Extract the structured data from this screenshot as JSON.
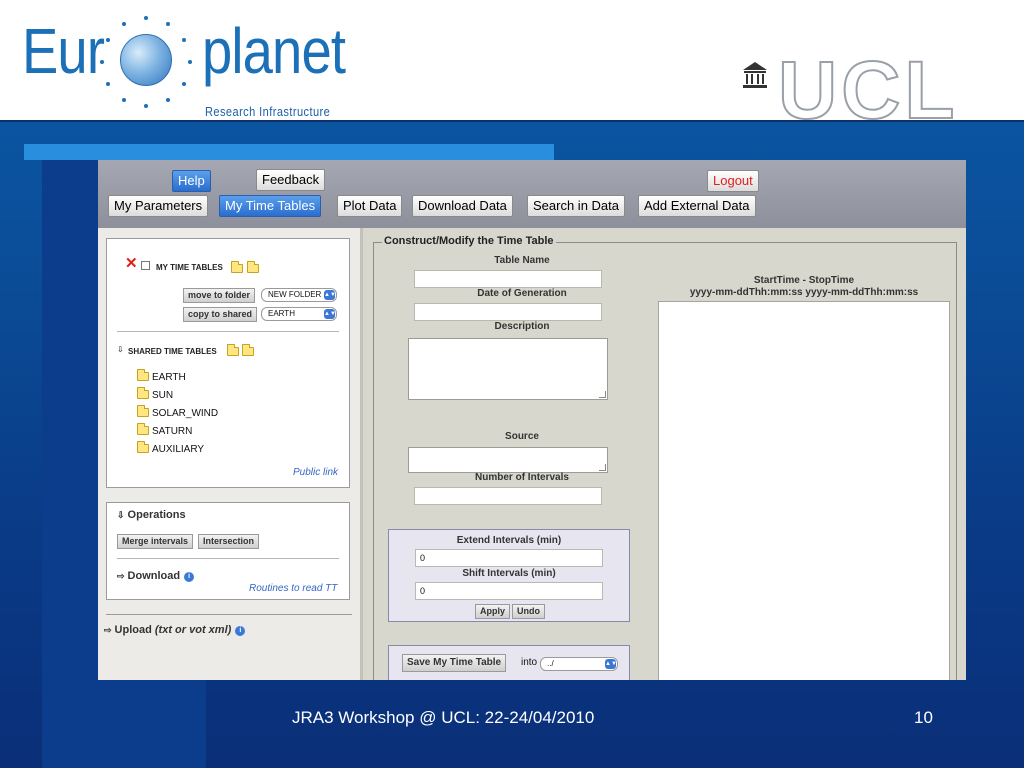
{
  "header": {
    "logo_left_part": "Eur",
    "logo_right_part": "planet",
    "logo_subtitle": "Research Infrastructure",
    "institution_logo": "UCL"
  },
  "toolbar": {
    "help_label": "Help",
    "feedback_label": "Feedback",
    "logout_label": "Logout",
    "tabs": [
      {
        "label": "My Parameters"
      },
      {
        "label": "My Time Tables"
      },
      {
        "label": "Plot Data"
      },
      {
        "label": "Download Data"
      },
      {
        "label": "Search in Data"
      },
      {
        "label": "Add External Data"
      }
    ]
  },
  "my_time_tables": {
    "title": "MY TIME TABLES",
    "move_to_folder_label": "move to folder",
    "move_to_folder_selected": "NEW FOLDER",
    "copy_to_shared_label": "copy to shared",
    "copy_to_shared_selected": "EARTH",
    "shared_title": "SHARED TIME TABLES",
    "folders": [
      {
        "name": "EARTH"
      },
      {
        "name": "SUN"
      },
      {
        "name": "SOLAR_WIND"
      },
      {
        "name": "SATURN"
      },
      {
        "name": "AUXILIARY"
      }
    ],
    "public_link": "Public link"
  },
  "operations": {
    "title": "Operations",
    "merge_label": "Merge intervals",
    "intersection_label": "Intersection",
    "download_title": "Download",
    "routines_link": "Routines to read TT",
    "upload_title": "Upload",
    "upload_hint": "(txt or vot xml)"
  },
  "construct": {
    "legend": "Construct/Modify the Time Table",
    "table_name_label": "Table Name",
    "table_name_value": "",
    "date_label": "Date of Generation",
    "date_value": "",
    "description_label": "Description",
    "source_label": "Source",
    "num_intervals_label": "Number of Intervals",
    "num_intervals_value": "",
    "intervals_header_1": "StartTime - StopTime",
    "intervals_header_2": "yyyy-mm-ddThh:mm:ss yyyy-mm-ddThh:mm:ss",
    "extend_label": "Extend Intervals (min)",
    "extend_value": "0",
    "shift_label": "Shift Intervals (min)",
    "shift_value": "0",
    "apply_label": "Apply",
    "undo_label": "Undo",
    "save_label": "Save My Time Table",
    "into_label": "into",
    "into_selected": "../"
  },
  "footer": {
    "text": "JRA3 Workshop @ UCL: 22-24/04/2010",
    "page": "10"
  },
  "colors": {
    "accent_blue": "#2a8ede",
    "logout_red": "#e0201c",
    "active_tab": "#2a6dd0"
  }
}
